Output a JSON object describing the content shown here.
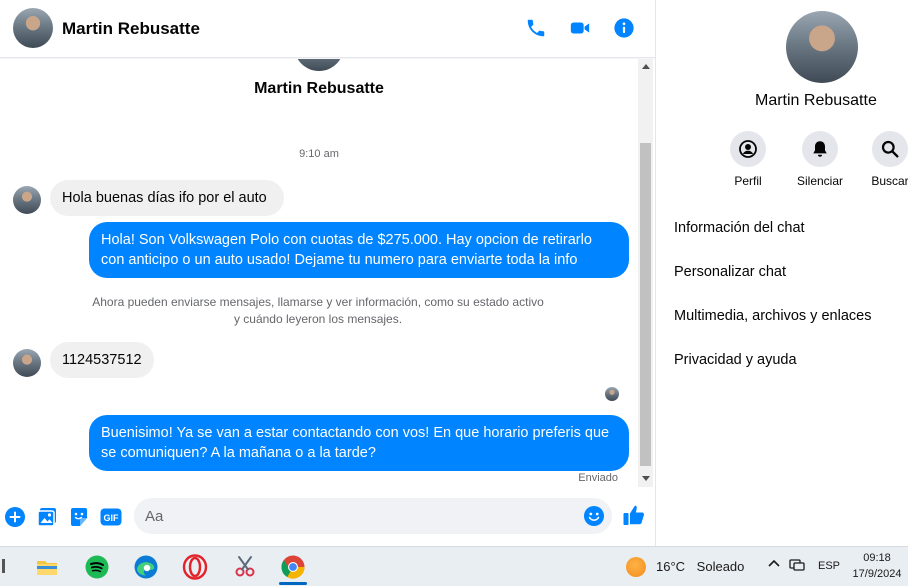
{
  "header": {
    "contact_name": "Martin Rebusatte",
    "icons": [
      "phone-icon",
      "video-icon",
      "info-icon"
    ],
    "accent_color": "#0084ff"
  },
  "conversation": {
    "contact_name": "Martin Rebusatte",
    "timestamp": "9:10 am",
    "messages": [
      {
        "direction": "incoming",
        "text": "Hola buenas días ifo por el auto"
      },
      {
        "direction": "outgoing",
        "text": "Hola! Son Volkswagen Polo con cuotas de $275.000. Hay opcion de retirarlo con anticipo o un auto usado! Dejame tu numero para enviarte toda la info"
      },
      {
        "direction": "incoming",
        "text": "1124537512"
      },
      {
        "direction": "outgoing",
        "text": "Buenisimo! Ya se van a estar contactando con vos! En que horario preferis que se comuniquen? A la mañana o a la tarde?"
      }
    ],
    "system_notice": "Ahora pueden enviarse mensajes, llamarse y ver información, como su estado activo y cuándo leyeron los mensajes.",
    "status": "Enviado",
    "incoming_bubble_color": "#f0f0f0",
    "outgoing_bubble_color": "#0084ff"
  },
  "composer": {
    "placeholder": "Aa",
    "icons": [
      "plus-icon",
      "image-icon",
      "sticker-icon",
      "gif-icon",
      "emoji-icon",
      "like-icon"
    ]
  },
  "sidebar": {
    "contact_name": "Martin Rebusatte",
    "actions": [
      {
        "label": "Perfil",
        "icon": "profile-icon"
      },
      {
        "label": "Silenciar",
        "icon": "bell-icon"
      },
      {
        "label": "Buscar",
        "icon": "search-icon"
      }
    ],
    "sections": [
      "Información del chat",
      "Personalizar chat",
      "Multimedia, archivos y enlaces",
      "Privacidad y ayuda"
    ]
  },
  "taskbar": {
    "apps": [
      "file-explorer-icon",
      "spotify-icon",
      "edge-icon",
      "opera-icon",
      "snipping-tool-icon",
      "chrome-icon"
    ],
    "weather": {
      "temperature": "16°C",
      "condition": "Soleado"
    },
    "language": "ESP",
    "time": "09:18",
    "date": "17/9/2024"
  }
}
